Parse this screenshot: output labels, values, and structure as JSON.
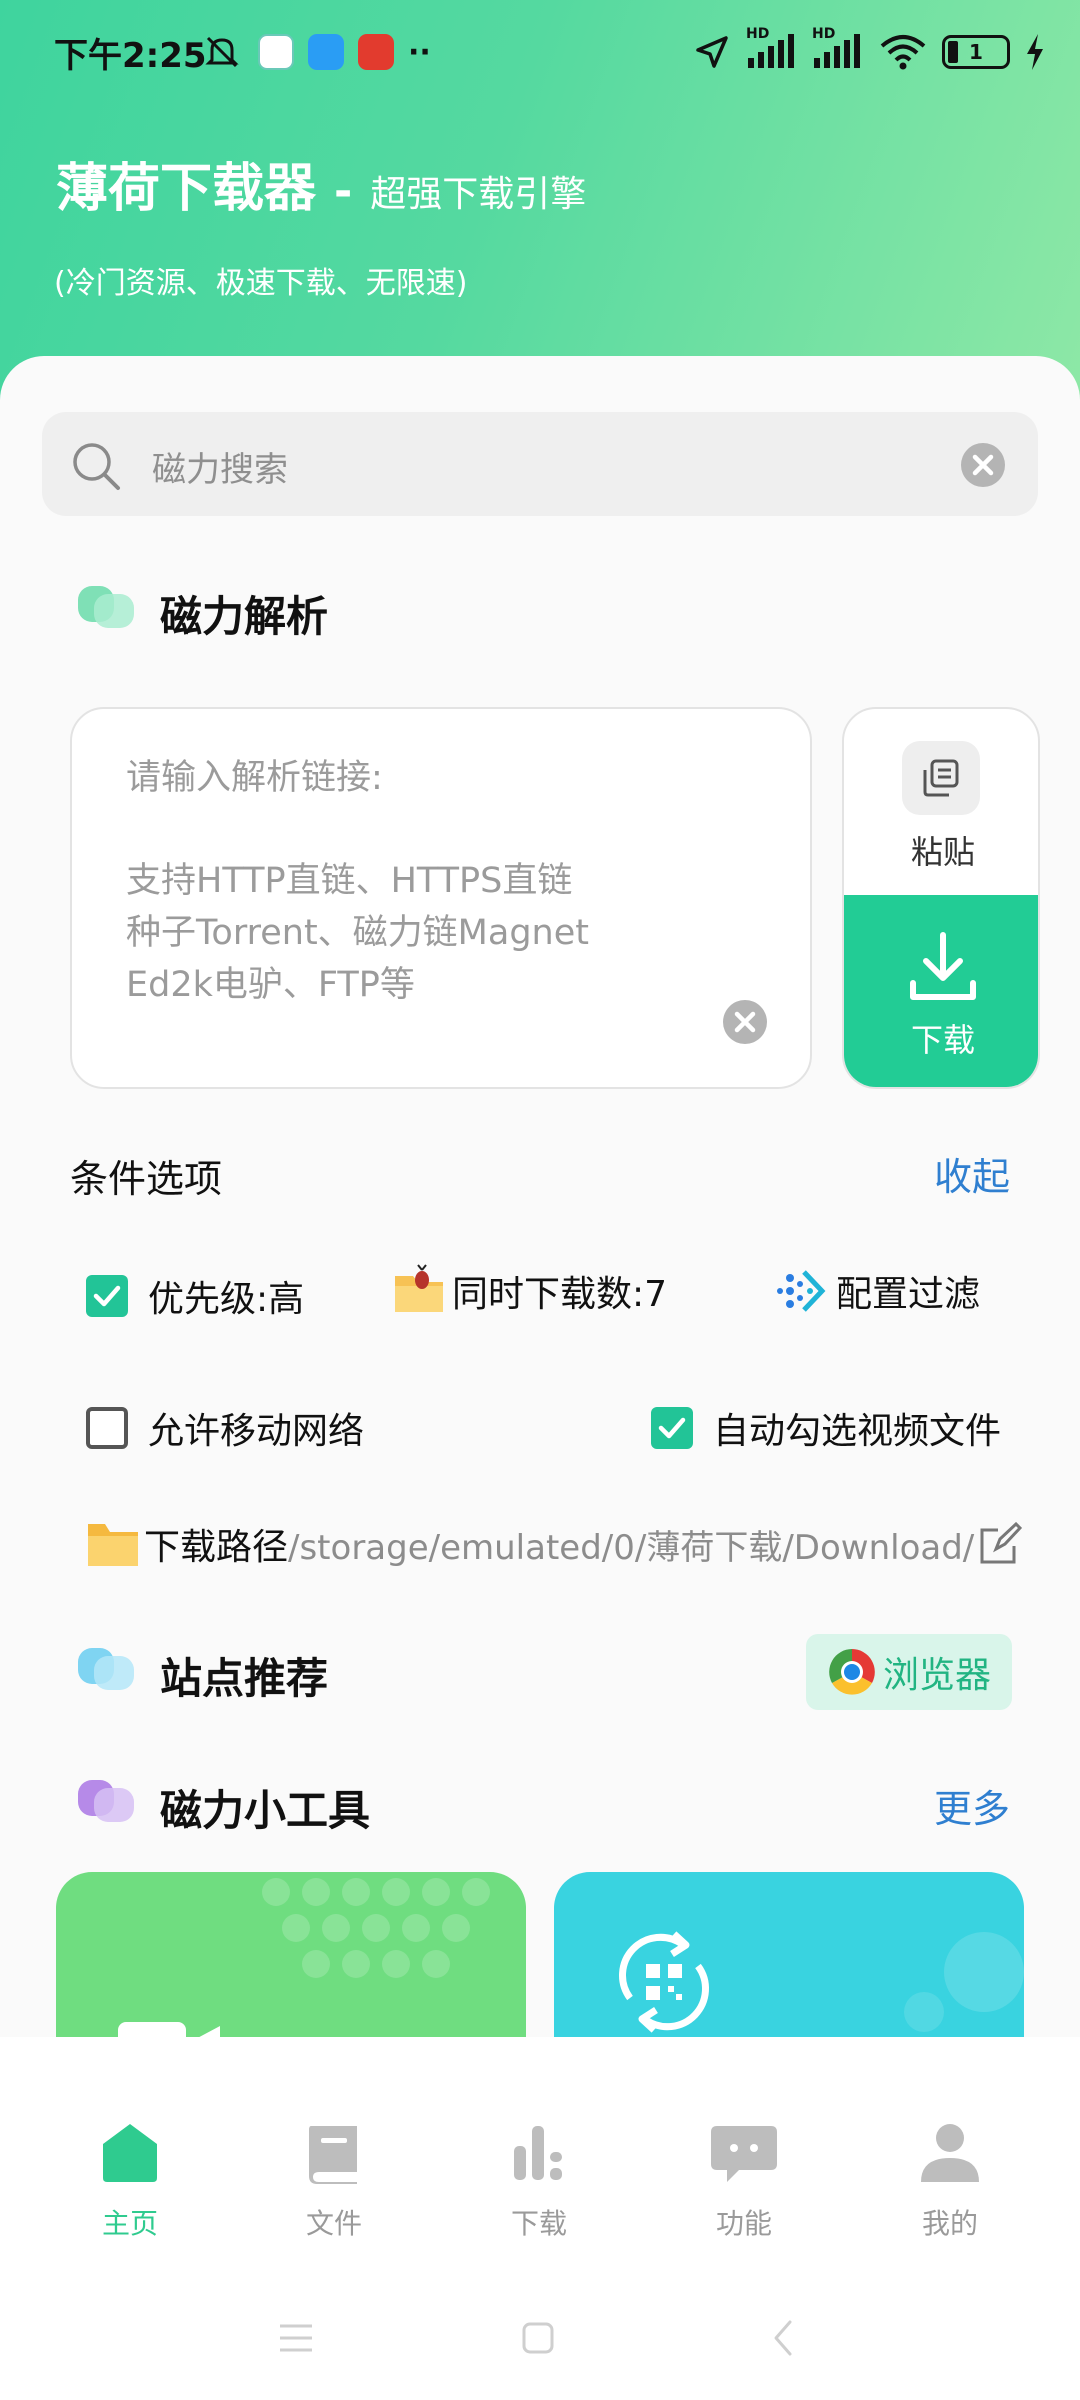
{
  "status_bar": {
    "time": "下午2:25",
    "more": "··",
    "network1": "HD",
    "network2": "HD",
    "battery": "1"
  },
  "header": {
    "app_name": "薄荷下载器",
    "dash": "-",
    "tagline": "超强下载引擎",
    "subtitle": "(冷门资源、极速下载、无限速)"
  },
  "search": {
    "placeholder": "磁力搜索"
  },
  "parse_section": {
    "title": "磁力解析",
    "input_label": "请输入解析链接:",
    "input_hint_lines": [
      "支持HTTP直链、HTTPS直链",
      "种子Torrent、磁力链Magnet",
      "Ed2k电驴、FTP等"
    ],
    "paste_label": "粘贴",
    "download_label": "下载"
  },
  "options": {
    "title": "条件选项",
    "collapse": "收起",
    "priority": "优先级:高",
    "concurrent": "同时下载数:7",
    "filter": "配置过滤",
    "allow_mobile": "允许移动网络",
    "auto_select_video": "自动勾选视频文件",
    "priority_checked": true,
    "allow_mobile_checked": false,
    "auto_select_checked": true,
    "path_label": "下载路径",
    "path_value": "/storage/emulated/0/薄荷下载/Download/"
  },
  "sites": {
    "title": "站点推荐",
    "browser_button": "浏览器"
  },
  "tools": {
    "title": "磁力小工具",
    "more": "更多"
  },
  "tabs": [
    {
      "label": "主页",
      "icon": "home-icon",
      "active": true
    },
    {
      "label": "文件",
      "icon": "book-icon",
      "active": false
    },
    {
      "label": "下载",
      "icon": "bar-chart-icon",
      "active": false
    },
    {
      "label": "功能",
      "icon": "chat-icon",
      "active": false
    },
    {
      "label": "我的",
      "icon": "user-icon",
      "active": false
    }
  ],
  "colors": {
    "accent": "#22cc95",
    "link": "#2f7fd0"
  }
}
